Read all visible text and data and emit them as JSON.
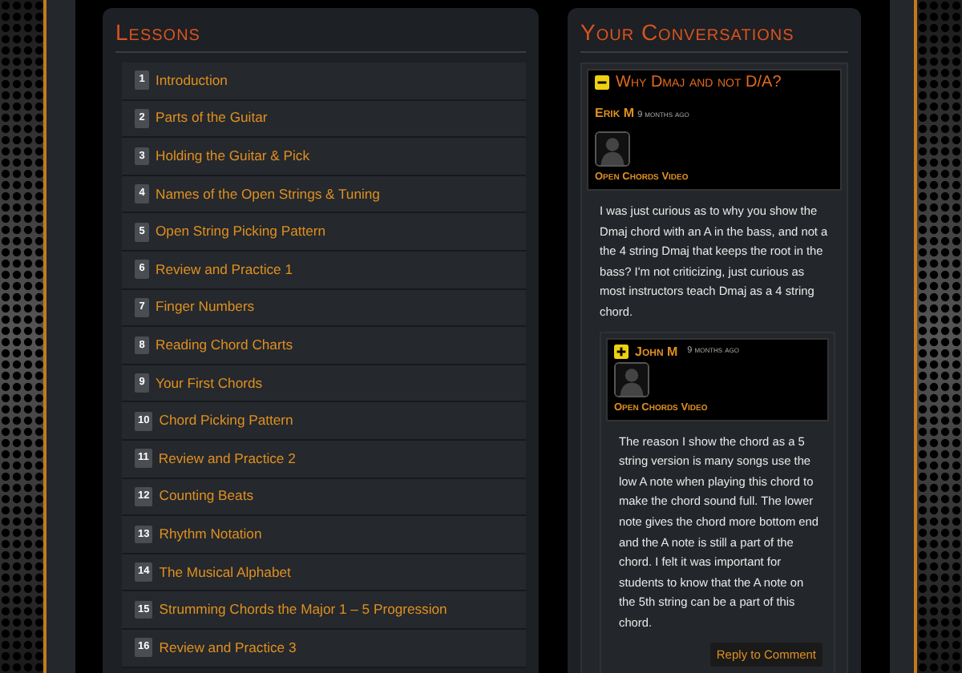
{
  "lessons": {
    "title": "Lessons",
    "items": [
      {
        "number": "1",
        "label": "Introduction"
      },
      {
        "number": "2",
        "label": "Parts of the Guitar"
      },
      {
        "number": "3",
        "label": "Holding the Guitar & Pick"
      },
      {
        "number": "4",
        "label": "Names of the Open Strings & Tuning"
      },
      {
        "number": "5",
        "label": "Open String Picking Pattern"
      },
      {
        "number": "6",
        "label": "Review and Practice 1"
      },
      {
        "number": "7",
        "label": "Finger Numbers"
      },
      {
        "number": "8",
        "label": "Reading Chord Charts"
      },
      {
        "number": "9",
        "label": "Your First Chords"
      },
      {
        "number": "10",
        "label": "Chord Picking Pattern"
      },
      {
        "number": "11",
        "label": "Review and Practice 2"
      },
      {
        "number": "12",
        "label": "Counting Beats"
      },
      {
        "number": "13",
        "label": "Rhythm Notation"
      },
      {
        "number": "14",
        "label": "The Musical Alphabet"
      },
      {
        "number": "15",
        "label": "Strumming Chords the Major 1 – 5 Progression"
      },
      {
        "number": "16",
        "label": "Review and Practice 3"
      }
    ]
  },
  "conversations": {
    "title": "Your Conversations",
    "thread": {
      "title": "Why Dmaj and not D/A?",
      "expanded": true,
      "author": "Erik M",
      "time": "9 months ago",
      "video": "Open Chords Video",
      "body": "I was just curious as to why you show the Dmaj chord with an A in the bass, and not a the 4 string Dmaj that keeps the root in the bass?  I'm not criticizing, just curious as most instructors teach Dmaj as a 4 string chord.",
      "reply": {
        "expanded": false,
        "author": "John M",
        "time": "9 months ago",
        "video": "Open Chords Video",
        "body": "The reason I show the chord as a 5 string version is many songs use the low A note when playing this chord to make the chord sound full. The lower note gives the chord more bottom end and the A note is still a part of the chord. I felt it was important for students to know that the A note on the 5th string can be a part of this chord.",
        "button": "Reply to Comment"
      }
    }
  }
}
